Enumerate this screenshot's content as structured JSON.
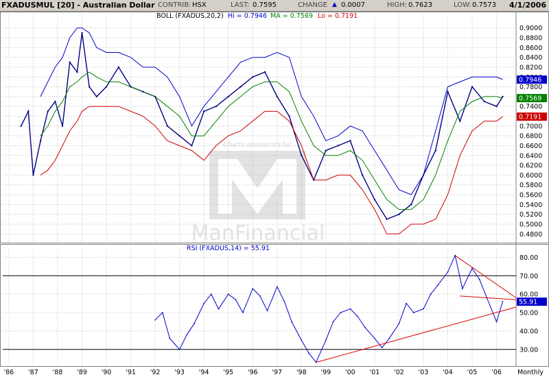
{
  "header": {
    "title": "FXADUSMUL [20] - Australian Dollar",
    "contrib_label": "CONTRIB:",
    "contrib_value": "HSX",
    "last_label": "LAST:",
    "last_value": "0.7595",
    "change_label": "CHANGE",
    "change_value": "0.0007",
    "high_label": "HIGH:",
    "high_value": "0.7623",
    "low_label": "LOW:",
    "low_value": "0.7573",
    "date": "4/1/2006"
  },
  "colors": {
    "price": "#000080",
    "upper_band": "#0000cc",
    "ma": "#008000",
    "lower_band": "#cc0000",
    "rsi": "#0000cc",
    "trendline": "#dd0000",
    "grid": "#c0c0c0"
  },
  "watermark": {
    "sponsor": "Charts sponsored by:",
    "brand": "ManFinancial"
  },
  "chart_data": [
    {
      "type": "line",
      "panel": "price",
      "legend": {
        "prefix": "BOLL (FXADUS,20,2)",
        "hi_label": "Hi = 0.7946",
        "ma_label": "MA = 0.7569",
        "lo_label": "Lo = 0.7191"
      },
      "ylim": [
        0.465,
        0.915
      ],
      "yticks": [
        "0.9000",
        "0.8800",
        "0.8600",
        "0.8400",
        "0.8200",
        "0.8000",
        "0.7800",
        "0.7600",
        "0.7400",
        "0.7200",
        "0.7000",
        "0.6800",
        "0.6600",
        "0.6400",
        "0.6200",
        "0.6000",
        "0.5800",
        "0.5600",
        "0.5400",
        "0.5200",
        "0.5000",
        "0.4800"
      ],
      "value_tags": [
        {
          "label": "0.7946",
          "value": 0.7946,
          "color": "#0000cc"
        },
        {
          "label": "0.7569",
          "value": 0.7569,
          "color": "#008000"
        },
        {
          "label": "0.7191",
          "value": 0.7191,
          "color": "#cc0000"
        }
      ],
      "x": [
        1986.5,
        1986.8,
        1987.0,
        1987.3,
        1987.6,
        1987.9,
        1988.2,
        1988.5,
        1988.8,
        1989.0,
        1989.3,
        1989.6,
        1990.0,
        1990.5,
        1991.0,
        1991.5,
        1992.0,
        1992.5,
        1993.0,
        1993.5,
        1994.0,
        1994.5,
        1995.0,
        1995.5,
        1996.0,
        1996.5,
        1997.0,
        1997.5,
        1998.0,
        1998.5,
        1999.0,
        1999.5,
        2000.0,
        2000.5,
        2001.0,
        2001.5,
        2002.0,
        2002.5,
        2003.0,
        2003.5,
        2004.0,
        2004.5,
        2005.0,
        2005.5,
        2006.0,
        2006.25
      ],
      "series": [
        {
          "name": "Price",
          "values": [
            0.7,
            0.73,
            0.6,
            0.67,
            0.73,
            0.75,
            0.7,
            0.83,
            0.81,
            0.89,
            0.78,
            0.76,
            0.78,
            0.82,
            0.78,
            0.77,
            0.76,
            0.7,
            0.68,
            0.66,
            0.73,
            0.74,
            0.76,
            0.78,
            0.8,
            0.81,
            0.76,
            0.72,
            0.64,
            0.59,
            0.65,
            0.66,
            0.67,
            0.6,
            0.55,
            0.51,
            0.52,
            0.54,
            0.6,
            0.65,
            0.77,
            0.71,
            0.78,
            0.75,
            0.74,
            0.76
          ]
        },
        {
          "name": "Hi",
          "values": [
            null,
            null,
            null,
            0.76,
            0.79,
            0.82,
            0.84,
            0.88,
            0.9,
            0.9,
            0.89,
            0.86,
            0.85,
            0.85,
            0.84,
            0.82,
            0.82,
            0.8,
            0.76,
            0.7,
            0.74,
            0.77,
            0.8,
            0.83,
            0.84,
            0.84,
            0.85,
            0.84,
            0.76,
            0.72,
            0.67,
            0.68,
            0.7,
            0.69,
            0.65,
            0.61,
            0.57,
            0.56,
            0.6,
            0.69,
            0.78,
            0.79,
            0.8,
            0.8,
            0.8,
            0.795
          ]
        },
        {
          "name": "MA",
          "values": [
            null,
            null,
            null,
            0.68,
            0.7,
            0.73,
            0.75,
            0.78,
            0.79,
            0.8,
            0.81,
            0.8,
            0.79,
            0.79,
            0.78,
            0.77,
            0.76,
            0.74,
            0.72,
            0.68,
            0.68,
            0.71,
            0.74,
            0.76,
            0.78,
            0.79,
            0.79,
            0.77,
            0.71,
            0.66,
            0.64,
            0.64,
            0.65,
            0.63,
            0.59,
            0.55,
            0.53,
            0.53,
            0.55,
            0.6,
            0.67,
            0.73,
            0.75,
            0.76,
            0.76,
            0.757
          ]
        },
        {
          "name": "Lo",
          "values": [
            null,
            null,
            null,
            0.6,
            0.61,
            0.63,
            0.66,
            0.69,
            0.71,
            0.73,
            0.74,
            0.74,
            0.74,
            0.74,
            0.73,
            0.72,
            0.7,
            0.67,
            0.66,
            0.65,
            0.63,
            0.66,
            0.68,
            0.69,
            0.71,
            0.73,
            0.73,
            0.71,
            0.66,
            0.59,
            0.59,
            0.6,
            0.6,
            0.57,
            0.53,
            0.48,
            0.48,
            0.5,
            0.5,
            0.51,
            0.56,
            0.64,
            0.69,
            0.71,
            0.71,
            0.719
          ]
        }
      ]
    },
    {
      "type": "line",
      "panel": "rsi",
      "title": "RSI (FXADUS,14) = 55.91",
      "ylim": [
        21,
        82
      ],
      "yticks": [
        "80.00",
        "70.00",
        "60.00",
        "50.00",
        "40.00",
        "30.00"
      ],
      "reference_lines": [
        70,
        30
      ],
      "value_tags": [
        {
          "label": "55.91",
          "value": 55.91,
          "color": "#0000cc"
        }
      ],
      "x": [
        1992.0,
        1992.3,
        1992.6,
        1993.0,
        1993.3,
        1993.6,
        1994.0,
        1994.3,
        1994.6,
        1995.0,
        1995.3,
        1995.6,
        1996.0,
        1996.3,
        1996.6,
        1997.0,
        1997.3,
        1997.6,
        1998.0,
        1998.3,
        1998.6,
        1999.0,
        1999.3,
        1999.6,
        2000.0,
        2000.3,
        2000.6,
        2001.0,
        2001.3,
        2001.6,
        2002.0,
        2002.3,
        2002.6,
        2003.0,
        2003.3,
        2003.6,
        2004.0,
        2004.3,
        2004.6,
        2005.0,
        2005.3,
        2005.6,
        2006.0,
        2006.25
      ],
      "series": [
        {
          "name": "RSI",
          "values": [
            46,
            50,
            36,
            30,
            38,
            44,
            55,
            60,
            52,
            60,
            57,
            50,
            63,
            59,
            51,
            64,
            56,
            45,
            35,
            28,
            23,
            35,
            45,
            50,
            52,
            48,
            42,
            36,
            31,
            36,
            44,
            55,
            50,
            52,
            60,
            65,
            72,
            81,
            63,
            74,
            68,
            58,
            45,
            56
          ]
        }
      ],
      "trendlines": [
        {
          "from": [
            1998.6,
            23
          ],
          "to": [
            2006.8,
            53
          ]
        },
        {
          "from": [
            2004.3,
            81
          ],
          "to": [
            2006.8,
            58
          ]
        },
        {
          "from": [
            2004.5,
            59
          ],
          "to": [
            2006.8,
            57
          ]
        }
      ]
    }
  ],
  "x_axis": {
    "min": 1985.75,
    "max": 2006.8,
    "labels": [
      {
        "text": "'86",
        "year": 1986
      },
      {
        "text": "'87",
        "year": 1987
      },
      {
        "text": "'88",
        "year": 1988
      },
      {
        "text": "'89",
        "year": 1989
      },
      {
        "text": "'90",
        "year": 1990
      },
      {
        "text": "'91",
        "year": 1991
      },
      {
        "text": "'92",
        "year": 1992
      },
      {
        "text": "'93",
        "year": 1993
      },
      {
        "text": "'94",
        "year": 1994
      },
      {
        "text": "'95",
        "year": 1995
      },
      {
        "text": "'96",
        "year": 1996
      },
      {
        "text": "'97",
        "year": 1997
      },
      {
        "text": "'98",
        "year": 1998
      },
      {
        "text": "'99",
        "year": 1999
      },
      {
        "text": "'00",
        "year": 2000
      },
      {
        "text": "'01",
        "year": 2001
      },
      {
        "text": "'02",
        "year": 2002
      },
      {
        "text": "'03",
        "year": 2003
      },
      {
        "text": "'04",
        "year": 2004
      },
      {
        "text": "'05",
        "year": 2005
      },
      {
        "text": "'06",
        "year": 2006
      }
    ],
    "period_label": "Monthly"
  }
}
